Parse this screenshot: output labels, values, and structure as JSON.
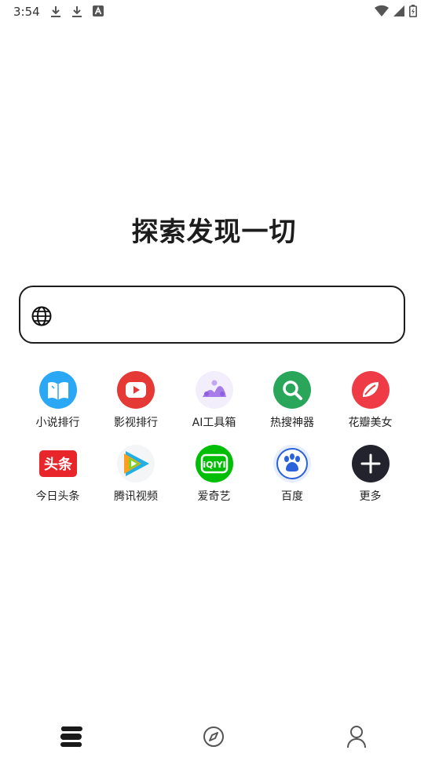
{
  "status_bar": {
    "time": "3:54",
    "left_icons": [
      "download-icon",
      "download-icon",
      "keyboard-a-icon"
    ],
    "right_icons": [
      "wifi-icon",
      "signal-icon",
      "battery-charging-icon"
    ]
  },
  "hero": {
    "title": "探索发现一切"
  },
  "search": {
    "value": "",
    "placeholder": ""
  },
  "shortcuts": [
    {
      "label": "小说排行",
      "icon": "book-icon",
      "color": "#2aa7f5"
    },
    {
      "label": "影视排行",
      "icon": "video-play-icon",
      "color": "#e53935"
    },
    {
      "label": "AI工具箱",
      "icon": "ai-toolbox-icon",
      "color": "#a77ce8"
    },
    {
      "label": "热搜神器",
      "icon": "magnifier-icon",
      "color": "#29a65a"
    },
    {
      "label": "花瓣美女",
      "icon": "petal-icon",
      "color": "#ef3b45"
    },
    {
      "label": "今日头条",
      "icon": "toutiao-logo",
      "color": "#e8252b",
      "logo_text": "头条"
    },
    {
      "label": "腾讯视频",
      "icon": "tencent-video-logo",
      "color": "#1fb0e6"
    },
    {
      "label": "爱奇艺",
      "icon": "iqiyi-logo",
      "color": "#00be06",
      "logo_text": "iQIYI"
    },
    {
      "label": "百度",
      "icon": "baidu-paw-logo",
      "color": "#2b61d9"
    },
    {
      "label": "更多",
      "icon": "plus-icon",
      "color": "#23232e"
    }
  ],
  "bottom_nav": [
    {
      "name": "home",
      "icon": "home-stack-icon",
      "active": true
    },
    {
      "name": "discover",
      "icon": "compass-icon",
      "active": false
    },
    {
      "name": "profile",
      "icon": "person-icon",
      "active": false
    }
  ]
}
